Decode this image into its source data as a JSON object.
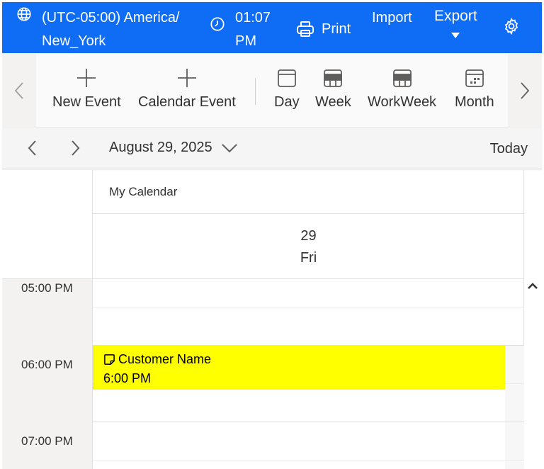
{
  "header": {
    "timezone_line1": "(UTC-05:00) America/",
    "timezone_line2": "New_York",
    "time_line1": "01:07",
    "time_line2": "PM",
    "print_label": "Print",
    "import_label": "Import",
    "export_label": "Export"
  },
  "toolbar": {
    "new_event": "New Event",
    "calendar_event": "Calendar Event",
    "day": "Day",
    "week": "Week",
    "workweek": "WorkWeek",
    "month": "Month"
  },
  "datebar": {
    "date": "August 29, 2025",
    "today": "Today"
  },
  "calendar": {
    "resource": "My Calendar",
    "day_number": "29",
    "day_name": "Fri",
    "times": [
      "05:00 PM",
      "06:00 PM",
      "07:00 PM"
    ],
    "event": {
      "title": "Customer Name",
      "time": "6:00 PM",
      "color": "#ffff00"
    }
  },
  "colors": {
    "brand": "#0f6cf5"
  },
  "icons": [
    "globe-icon",
    "clock-icon",
    "printer-icon",
    "chevron-down-icon",
    "gear-icon",
    "plus-icon",
    "calendar-day-icon",
    "calendar-week-icon",
    "calendar-month-icon",
    "chevron-left-icon",
    "chevron-right-icon",
    "chevron-up-icon",
    "note-icon"
  ]
}
